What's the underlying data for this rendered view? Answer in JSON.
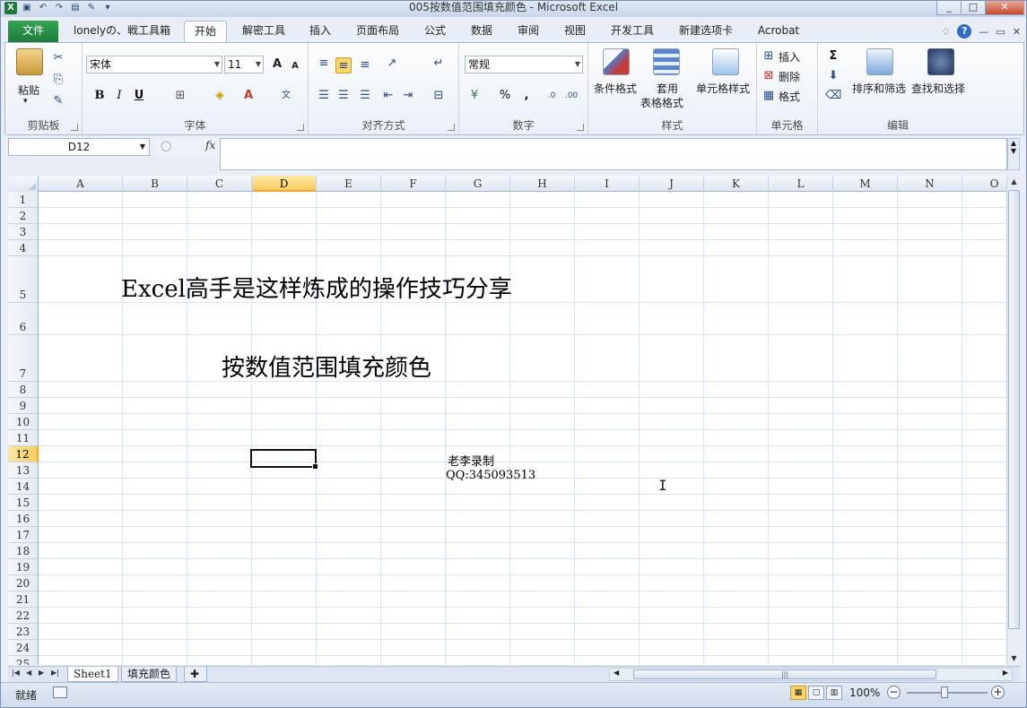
{
  "window": {
    "title": "005按数值范围填充颜色  -  Microsoft Excel",
    "controls": [
      "_",
      "□",
      "✕"
    ]
  },
  "tabs": [
    {
      "label": "文件"
    },
    {
      "label": "lonelyの、戦工具箱"
    },
    {
      "label": "开始"
    },
    {
      "label": "解密工具"
    },
    {
      "label": "插入"
    },
    {
      "label": "页面布局"
    },
    {
      "label": "公式"
    },
    {
      "label": "数据"
    },
    {
      "label": "审阅"
    },
    {
      "label": "视图"
    },
    {
      "label": "开发工具"
    },
    {
      "label": "新建选项卡"
    },
    {
      "label": "Acrobat"
    }
  ],
  "ribbon": {
    "clipboard": {
      "label": "剪贴板",
      "paste": "粘贴"
    },
    "font": {
      "label": "字体",
      "name": "宋体",
      "size": "11",
      "bold": "B",
      "italic": "I",
      "underline": "U"
    },
    "alignment": {
      "label": "对齐方式"
    },
    "number": {
      "label": "数字",
      "format": "常规",
      "percent": "%",
      "comma": ","
    },
    "styles": {
      "label": "样式",
      "conditional": "条件格式",
      "table1": "套用",
      "table2": "表格格式",
      "cell": "单元格样式"
    },
    "cells": {
      "label": "单元格",
      "insert": "插入",
      "delete": "删除",
      "format": "格式"
    },
    "editing": {
      "label": "编辑",
      "sort": "排序和筛选",
      "find": "查找和选择",
      "sum": "Σ"
    }
  },
  "formula_bar": {
    "name_box": "D12",
    "fx": "fx",
    "content": ""
  },
  "columns": [
    "A",
    "B",
    "C",
    "D",
    "E",
    "F",
    "G",
    "H",
    "I",
    "J",
    "K",
    "L",
    "M",
    "N",
    "O"
  ],
  "rows": [
    "1",
    "2",
    "3",
    "4",
    "5",
    "6",
    "7",
    "8",
    "9",
    "10",
    "11",
    "12",
    "13",
    "14",
    "15",
    "16",
    "17",
    "18",
    "19",
    "20",
    "21",
    "22",
    "23",
    "24",
    "25"
  ],
  "cells": {
    "B5": "Excel高手是这样炼成的操作技巧分享",
    "D7": "按数值范围填充颜色",
    "G12": "老李录制",
    "G13": "QQ:345093513"
  },
  "active_cell": "D12",
  "sheets": [
    {
      "label": "Sheet1"
    },
    {
      "label": "填充颜色"
    }
  ],
  "status": {
    "ready": "就绪",
    "zoom": "100%"
  }
}
